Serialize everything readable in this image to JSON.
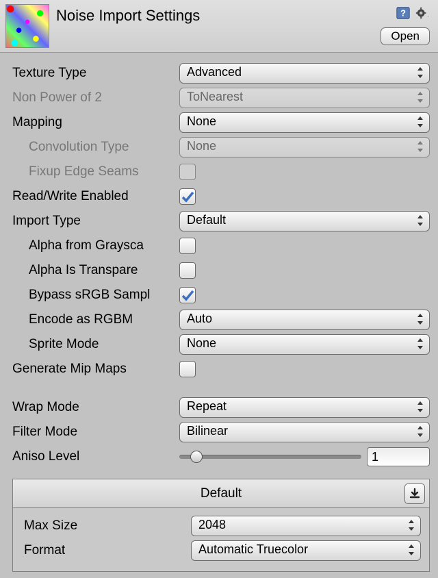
{
  "header": {
    "title": "Noise Import Settings",
    "open_label": "Open"
  },
  "fields": {
    "texture_type": {
      "label": "Texture Type",
      "value": "Advanced"
    },
    "non_power_of_2": {
      "label": "Non Power of 2",
      "value": "ToNearest"
    },
    "mapping": {
      "label": "Mapping",
      "value": "None"
    },
    "convolution_type": {
      "label": "Convolution Type",
      "value": "None"
    },
    "fixup_edge_seams": {
      "label": "Fixup Edge Seams",
      "checked": false
    },
    "read_write": {
      "label": "Read/Write Enabled",
      "checked": true
    },
    "import_type": {
      "label": "Import Type",
      "value": "Default"
    },
    "alpha_gray": {
      "label": "Alpha from Graysca",
      "checked": false
    },
    "alpha_transparent": {
      "label": "Alpha Is Transpare",
      "checked": false
    },
    "bypass_srgb": {
      "label": "Bypass sRGB Sampl",
      "checked": true
    },
    "encode_rgbm": {
      "label": "Encode as RGBM",
      "value": "Auto"
    },
    "sprite_mode": {
      "label": "Sprite Mode",
      "value": "None"
    },
    "generate_mipmaps": {
      "label": "Generate Mip Maps",
      "checked": false
    },
    "wrap_mode": {
      "label": "Wrap Mode",
      "value": "Repeat"
    },
    "filter_mode": {
      "label": "Filter Mode",
      "value": "Bilinear"
    },
    "aniso_level": {
      "label": "Aniso Level",
      "value": "1"
    }
  },
  "platform": {
    "tab": "Default",
    "max_size": {
      "label": "Max Size",
      "value": "2048"
    },
    "format": {
      "label": "Format",
      "value": "Automatic Truecolor"
    }
  }
}
